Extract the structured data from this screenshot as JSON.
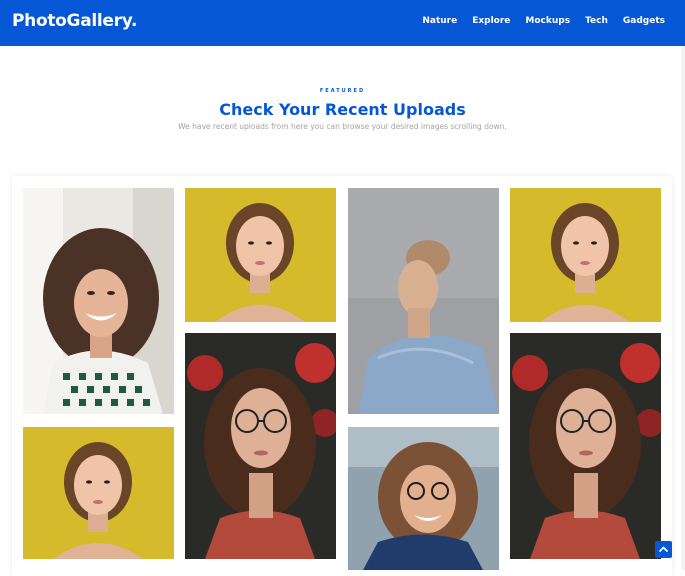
{
  "brand": "PhotoGallery.",
  "nav": [
    "Nature",
    "Explore",
    "Mockups",
    "Tech",
    "Gadgets"
  ],
  "section": {
    "featured": "FEATURED",
    "title": "Check Your Recent Uploads",
    "subtitle": "We have recent uploads from here you can browse your desired images scrolling down."
  },
  "icons": {
    "scroll_top": "chevron-up-icon"
  },
  "colors": {
    "brand": "#0557d6",
    "photo_yellow": "#d5ba2b",
    "photo_gray": "#9ea0a3"
  }
}
